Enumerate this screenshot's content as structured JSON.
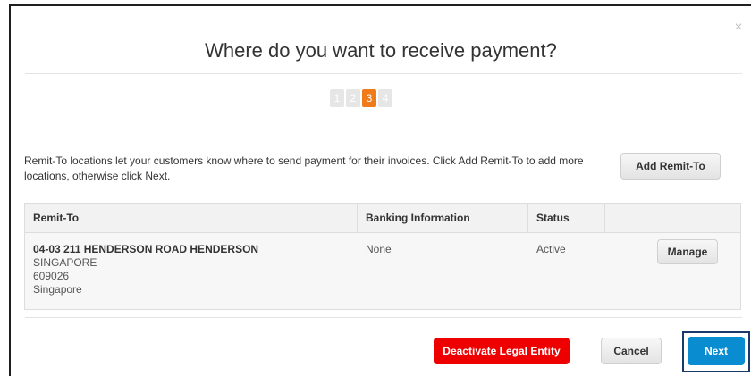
{
  "dialog": {
    "title": "Where do you want to receive payment?",
    "close_label": "×",
    "steps": [
      {
        "label": "1",
        "active": false
      },
      {
        "label": "2",
        "active": false
      },
      {
        "label": "3",
        "active": true
      },
      {
        "label": "4",
        "active": false
      }
    ],
    "intro_text": "Remit-To locations let your customers know where to send payment for their invoices. Click Add Remit-To to add more locations, otherwise click Next.",
    "add_button": "Add Remit-To"
  },
  "table": {
    "headers": [
      "Remit-To",
      "Banking Information",
      "Status",
      ""
    ],
    "rows": [
      {
        "remit_to": {
          "line1": "04-03 211 HENDERSON ROAD HENDERSON",
          "line2": "SINGAPORE",
          "line3": "609026",
          "line4": "Singapore"
        },
        "banking": "None",
        "status": "Active",
        "action": "Manage"
      }
    ]
  },
  "footer": {
    "deactivate": "Deactivate Legal Entity",
    "cancel": "Cancel",
    "next": "Next"
  },
  "colors": {
    "active_step": "#f07b1b",
    "deactivate": "#ee0000",
    "next": "#0a8cd0",
    "highlight_frame": "#1b3a6b"
  }
}
